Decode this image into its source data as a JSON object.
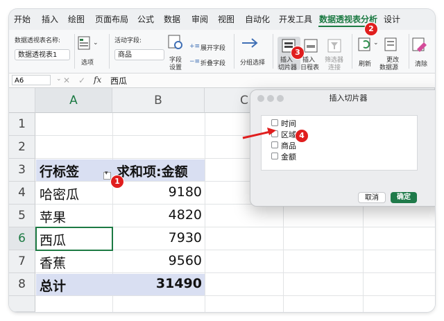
{
  "ribbon_tabs": [
    "开始",
    "插入",
    "绘图",
    "页面布局",
    "公式",
    "数据",
    "审阅",
    "视图",
    "自动化",
    "开发工具",
    "数据透视表分析",
    "设计"
  ],
  "ribbon": {
    "pivot_name_label": "数据透视表名称:",
    "pivot_name_value": "数据透视表1",
    "options": "选项",
    "active_field_label": "活动字段:",
    "active_field_value": "商品",
    "field_settings_1": "字段",
    "field_settings_2": "设置",
    "expand_field": "展开字段",
    "collapse_field": "折叠字段",
    "group_selection": "分组选择",
    "insert_slicer_1": "插入",
    "insert_slicer_2": "切片器",
    "insert_timeline_1": "插入",
    "insert_timeline_2": "日程表",
    "filter_conn_1": "筛选器",
    "filter_conn_2": "连接",
    "refresh": "刷新",
    "change_source_1": "更改",
    "change_source_2": "数据源",
    "clear": "清除"
  },
  "formula_bar": {
    "name_box": "A6",
    "fx": "fx",
    "content": "西瓜"
  },
  "columns": [
    "A",
    "B",
    "C"
  ],
  "rows": [
    "1",
    "2",
    "3",
    "4",
    "5",
    "6",
    "7",
    "8"
  ],
  "pivot": {
    "header_label": "行标签",
    "header_value": "求和项:金额",
    "items": [
      {
        "label": "哈密瓜",
        "value": "9180"
      },
      {
        "label": "苹果",
        "value": "4820"
      },
      {
        "label": "西瓜",
        "value": "7930"
      },
      {
        "label": "香蕉",
        "value": "9560"
      }
    ],
    "total_label": "总计",
    "total_value": "31490"
  },
  "dialog": {
    "title": "插入切片器",
    "fields": [
      "时间",
      "区域",
      "商品",
      "金额"
    ],
    "cancel": "取消",
    "ok": "确定"
  },
  "badges": [
    "1",
    "2",
    "3",
    "4"
  ],
  "colors": {
    "accent": "#1c7a43",
    "badge": "#e01e1e",
    "pivot_band": "#d9dff2"
  }
}
